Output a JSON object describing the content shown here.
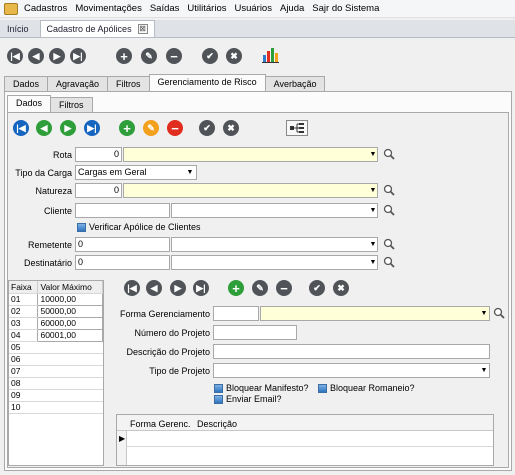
{
  "menu": {
    "items": [
      "Cadastros",
      "Movimentações",
      "Saídas",
      "Utilitários",
      "Usuários",
      "Ajuda",
      "Sajr do Sistema"
    ]
  },
  "doc_tabs": {
    "home": "Início",
    "current": "Cadastro de Apólices",
    "close": "⊠"
  },
  "main_tabs": [
    "Dados",
    "Agravação",
    "Filtros",
    "Gerenciamento de Risco",
    "Averbação"
  ],
  "sub_tabs": [
    "Dados",
    "Filtros"
  ],
  "form": {
    "rota": {
      "label": "Rota",
      "value": "0"
    },
    "tipo_carga": {
      "label": "Tipo da Carga",
      "value": "Cargas em Geral"
    },
    "natureza": {
      "label": "Natureza",
      "value": "0"
    },
    "cliente": {
      "label": "Cliente",
      "value": ""
    },
    "verificar": "Verificar Apólice de Clientes",
    "remetente": {
      "label": "Remetente",
      "value": "0"
    },
    "destinatario": {
      "label": "Destinatário",
      "value": "0"
    }
  },
  "faixa_table": {
    "headers": [
      "Faixa",
      "Valor Máximo"
    ],
    "rows": [
      [
        "01",
        "10000,00"
      ],
      [
        "02",
        "50000,00"
      ],
      [
        "03",
        "60000,00"
      ],
      [
        "04",
        "60001,00"
      ],
      [
        "05",
        ""
      ],
      [
        "06",
        ""
      ],
      [
        "07",
        ""
      ],
      [
        "08",
        ""
      ],
      [
        "09",
        ""
      ],
      [
        "10",
        ""
      ]
    ]
  },
  "gerenc": {
    "forma": {
      "label": "Forma Gerenciamento",
      "value": ""
    },
    "numero": {
      "label": "Número do Projeto",
      "value": ""
    },
    "descricao": {
      "label": "Descrição do Projeto",
      "value": ""
    },
    "tipo": {
      "label": "Tipo de Projeto",
      "value": ""
    },
    "chk_manifesto": "Bloquear Manifesto?",
    "chk_romaneio": "Bloquear Romaneio?",
    "chk_email": "Enviar Email?"
  },
  "grid": {
    "headers": [
      "Forma Gerenc.",
      "Descrição"
    ]
  },
  "colors": {
    "accent_blue": "#1565c0",
    "green": "#2e9e3a",
    "orange": "#f3a01d",
    "red": "#e02d20",
    "field_yellow": "#ffffd8"
  }
}
